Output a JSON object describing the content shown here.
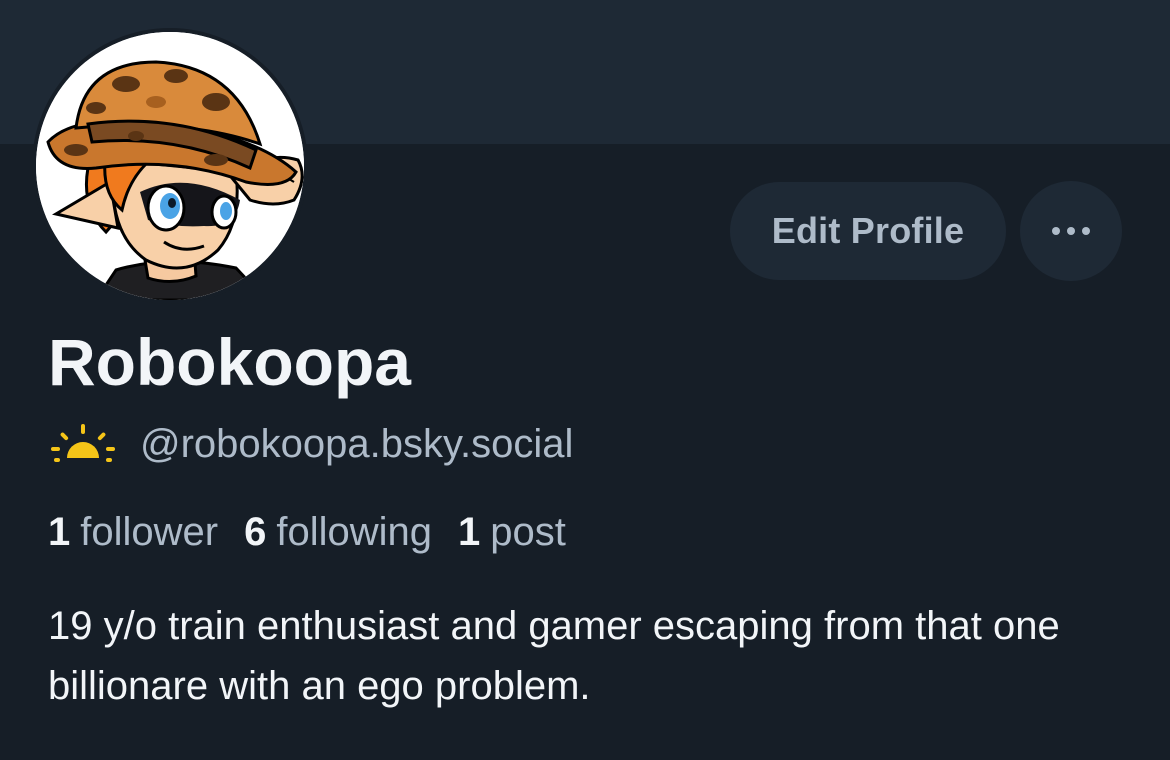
{
  "profile": {
    "display_name": "Robokoopa",
    "handle": "@robokoopa.bsky.social",
    "handle_icon": "sunrise-icon",
    "bio": "19 y/o train enthusiast and gamer escaping from that one billionare with an ego problem.",
    "avatar_icon": "avatar-character-with-camo-hat"
  },
  "actions": {
    "edit_profile_label": "Edit Profile",
    "more_icon": "ellipsis-icon"
  },
  "stats": {
    "followers_count": "1",
    "followers_label": "follower",
    "following_count": "6",
    "following_label": "following",
    "posts_count": "1",
    "posts_label": "post"
  },
  "colors": {
    "background": "#161e27",
    "banner": "#1e2935",
    "button": "#1e2935",
    "primary_text": "#f2f5f8",
    "secondary_text": "#aebbc9",
    "sun_icon": "#f5c518"
  }
}
